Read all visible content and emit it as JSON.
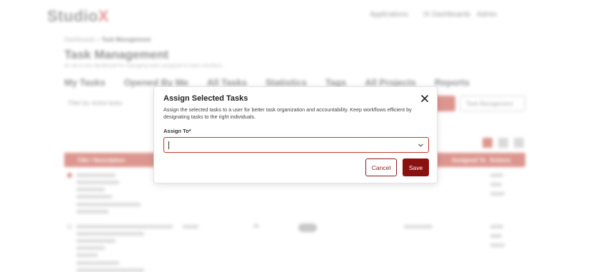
{
  "background": {
    "logo_main": "Studio",
    "logo_accent": "X",
    "nav": [
      "Applications",
      "IX Dashboards",
      "Admin"
    ],
    "breadcrumb": [
      "Dashboards",
      "Task Management"
    ],
    "page_title": "Task Management",
    "page_subtitle": "An all-in-one dashboard for managing tasks assigned to team members",
    "tabs": [
      "My Tasks",
      "Opened By Me",
      "All Tasks",
      "Statistics",
      "Tags",
      "All Projects",
      "Reports"
    ],
    "filter_label": "Filter by: Active tasks",
    "dropdown_label": "Task Management",
    "table_headers": [
      "Title / Description",
      "Assigned To",
      "Actions"
    ],
    "colors": {
      "accent": "#c0392b"
    }
  },
  "modal": {
    "title": "Assign Selected Tasks",
    "close_icon": "close-icon",
    "description": "Assign the selected tasks to a user for better task organization and accountability. Keep workflows efficient by designating tasks to the right individuals.",
    "field_label": "Assign To*",
    "field_value": "",
    "dropdown_icon": "chevron-down-icon",
    "cancel_label": "Cancel",
    "save_label": "Save",
    "colors": {
      "primary": "#8b1010",
      "border": "#c0392b"
    }
  }
}
